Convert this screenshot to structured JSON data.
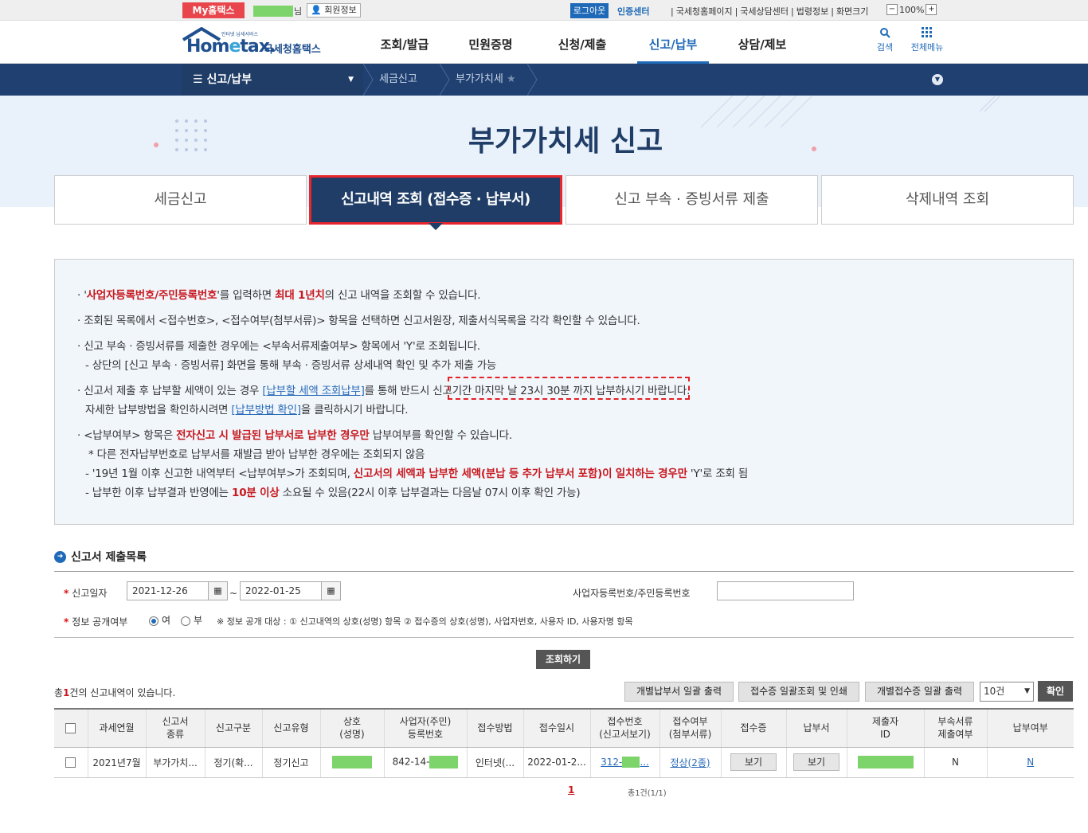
{
  "util": {
    "my_hometax": "My홈택스",
    "nim": "님",
    "member_info": "회원정보",
    "logout": "로그아웃",
    "cert_center": "인증센터",
    "links": [
      "국세청홈페이지",
      "국세상담센터",
      "법령정보",
      "화면크기"
    ],
    "zoom_level": "100%"
  },
  "header": {
    "logo_text_a": "Hom",
    "logo_text_b": "e",
    "logo_text_c": "tax.",
    "logo_kr": "국세청홈택스",
    "logo_small": "인터넷 납세서비스",
    "menus": [
      "조회/발급",
      "민원증명",
      "신청/제출",
      "신고/납부",
      "상담/제보"
    ],
    "active_menu": "신고/납부",
    "search": "검색",
    "all_menu": "전체메뉴"
  },
  "breadcrumb": {
    "section": "신고/납부",
    "item1": "세금신고",
    "item2": "부가가치세"
  },
  "banner": {
    "title": "부가가치세 신고"
  },
  "tabs": [
    {
      "label": "세금신고"
    },
    {
      "label": "신고내역 조회 (접수증 · 납부서)"
    },
    {
      "label": "신고 부속 · 증빙서류 제출"
    },
    {
      "label": "삭제내역 조회"
    }
  ],
  "info": {
    "l1a": "'",
    "l1b": "사업자등록번호/주민등록번호",
    "l1c": "'를 입력하면 ",
    "l1d": "최대 1년치",
    "l1e": "의 신고 내역을 조회할 수 있습니다.",
    "l2": "조회된 목록에서 <접수번호>, <접수여부(첨부서류)> 항목을 선택하면 신고서원장, 제출서식목록을 각각 확인할 수 있습니다.",
    "l3": "신고 부속 · 증빙서류를 제출한 경우에는 <부속서류제출여부> 항목에서 'Y'로 조회됩니다.",
    "l3sub": "- 상단의 [신고 부속 · 증빙서류] 화면을 통해 부속 · 증빙서류 상세내역 확인 및 추가 제출 가능",
    "l4a": "신고서 제출 후 납부할 세액이 있는 경우 ",
    "l4link": "[납부할 세액 조회납부]",
    "l4b": "를 통해 반드시 신고기간 마지막 날 23시 30분 까지 납부하시기 바랍니다.",
    "l4sub_a": "자세한 납부방법을 확인하시려면 ",
    "l4sublink": "[납부방법 확인]",
    "l4sub_b": "을 클릭하시기 바랍니다.",
    "l5a": "<납부여부> 항목은 ",
    "l5b": "전자신고 시 발급된 납부서로 납부한 경우만",
    "l5c": " 납부여부를 확인할 수 있습니다.",
    "l5s1": "* 다른 전자납부번호로 납부서를 재발급 받아 납부한 경우에는 조회되지 않음",
    "l5s2a": "- '19년 1월 이후 신고한 내역부터 <납부여부>가 조회되며, ",
    "l5s2b": "신고서의 세액과 납부한 세액(분납 등 추가 납부서 포함)이 일치하는 경우만",
    "l5s2c": " 'Y'로 조회 됨",
    "l5s3a": "- 납부한 이후 납부결과 반영에는 ",
    "l5s3b": "10분 이상",
    "l5s3c": " 소요될 수 있음(22시 이후 납부결과는 다음날 07시 이후 확인 가능)"
  },
  "list_section": {
    "title": "신고서 제출목록"
  },
  "form": {
    "date_label": "신고일자",
    "date_from": "2021-12-26",
    "date_to": "2022-01-25",
    "tilde": "~",
    "tin_label": "사업자등록번호/주민등록번호",
    "disclose_label": "정보 공개여부",
    "yes": "여",
    "no": "부",
    "disclose_note": "※ 정보 공개 대상 : ① 신고내역의 상호(성명) 항목 ② 접수증의 상호(성명), 사업자번호, 사용자 ID, 사용자명 항목"
  },
  "query_button": "조회하기",
  "result": {
    "total_a": "총",
    "total_count": "1",
    "total_b": "건의 신고내역이 있습니다.",
    "btn1": "개별납부서 일괄 출력",
    "btn2": "접수증 일괄조회 및 인쇄",
    "btn3": "개별접수증 일괄 출력",
    "page_size": "10건",
    "ok": "확인"
  },
  "table": {
    "headers": [
      "",
      "과세연월",
      "신고서\n종류",
      "신고구분",
      "신고유형",
      "상호\n(성명)",
      "사업자(주민)\n등록번호",
      "접수방법",
      "접수일시",
      "접수번호\n(신고서보기)",
      "접수여부\n(첨부서류)",
      "접수증",
      "납부서",
      "제출자\nID",
      "부속서류\n제출여부",
      "납부여부"
    ],
    "row": {
      "period": "2021년7월",
      "kind": "부가가치...",
      "div": "정기(확...",
      "type": "정기신고",
      "biz_prefix": "842-14-",
      "method": "인터넷(...",
      "datetime": "2022-01-2...",
      "receipt_prefix": "312-",
      "receipt_suffix": "...",
      "status": "정상(2종)",
      "receipt_btn": "보기",
      "pay_btn": "보기",
      "attach": "N",
      "paid": "N"
    }
  },
  "pager": {
    "current": "1",
    "count": "총1건(1/1)"
  }
}
